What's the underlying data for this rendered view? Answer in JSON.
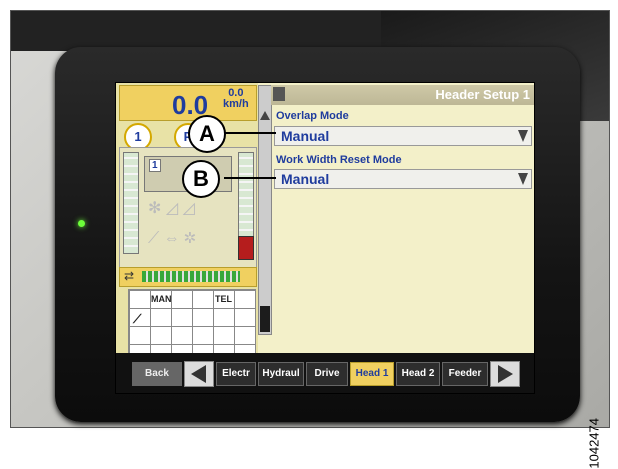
{
  "left_panel": {
    "speed_value": "0.0",
    "speed_small": "0.0",
    "speed_unit": "km/h",
    "circle1_label": "1",
    "circle2_label": "P",
    "mode_label": "1",
    "grid_labels": [
      "MAN",
      "TEL"
    ]
  },
  "header": {
    "title": "Header Setup 1"
  },
  "settings": [
    {
      "label": "Overlap Mode",
      "value": "Manual"
    },
    {
      "label": "Work Width Reset Mode",
      "value": "Manual"
    }
  ],
  "tabs": {
    "back": "Back",
    "items": [
      "Electr",
      "Hydraul",
      "Drive",
      "Head 1",
      "Head 2",
      "Feeder"
    ],
    "active": "Head 1"
  },
  "callouts": {
    "a": "A",
    "b": "B"
  },
  "image_id": "1042474",
  "colors": {
    "accent_yellow": "#f0d060",
    "text_blue": "#1f3c9e",
    "screen_bg": "#f3f0c9",
    "led_green": "#6dff3a"
  }
}
